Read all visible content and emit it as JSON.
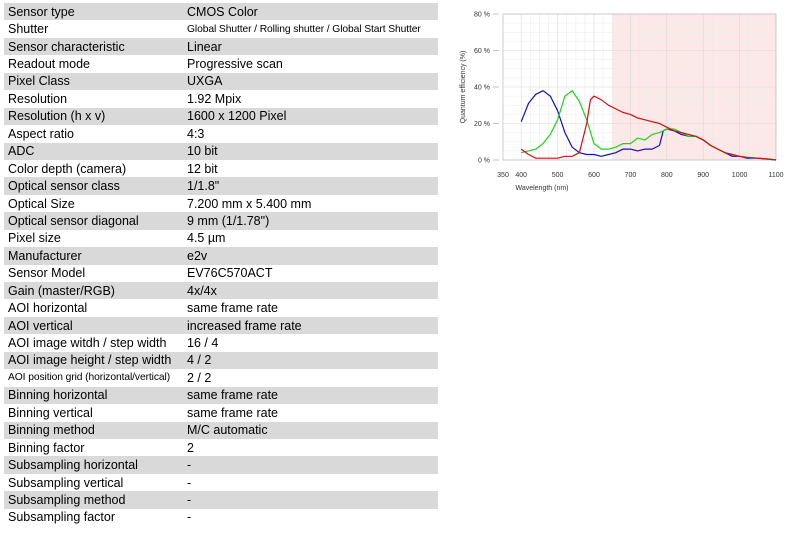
{
  "specs": [
    {
      "label": "Sensor type",
      "value": "CMOS Color"
    },
    {
      "label": "Shutter",
      "value": "Global Shutter / Rolling shutter / Global Start Shutter"
    },
    {
      "label": "Sensor characteristic",
      "value": "Linear"
    },
    {
      "label": "Readout mode",
      "value": "Progressive scan"
    },
    {
      "label": "Pixel Class",
      "value": "UXGA"
    },
    {
      "label": "Resolution",
      "value": "1.92 Mpix"
    },
    {
      "label": "Resolution (h x v)",
      "value": "1600 x 1200 Pixel"
    },
    {
      "label": "Aspect ratio",
      "value": "4:3"
    },
    {
      "label": "ADC",
      "value": "10 bit"
    },
    {
      "label": "Color depth (camera)",
      "value": "12 bit"
    },
    {
      "label": "Optical sensor class",
      "value": "1/1.8\""
    },
    {
      "label": "Optical Size",
      "value": "7.200 mm x 5.400 mm"
    },
    {
      "label": "Optical sensor diagonal",
      "value": "9 mm (1/1.78\")"
    },
    {
      "label": "Pixel size",
      "value": "4.5 µm"
    },
    {
      "label": "Manufacturer",
      "value": "e2v"
    },
    {
      "label": "Sensor Model",
      "value": "EV76C570ACT"
    },
    {
      "label": "Gain (master/RGB)",
      "value": "4x/4x"
    },
    {
      "label": "AOI horizontal",
      "value": "same frame rate"
    },
    {
      "label": "AOI vertical",
      "value": "increased frame rate"
    },
    {
      "label": "AOI image witdh / step width",
      "value": "16 / 4"
    },
    {
      "label": "AOI image height / step width",
      "value": "4 / 2"
    },
    {
      "label": "AOI position grid (horizontal/vertical)",
      "value": "2 / 2"
    },
    {
      "label": "Binning horizontal",
      "value": "same frame rate"
    },
    {
      "label": "Binning vertical",
      "value": "same frame rate"
    },
    {
      "label": "Binning method",
      "value": "M/C automatic"
    },
    {
      "label": "Binning factor",
      "value": "2"
    },
    {
      "label": "Subsampling horizontal",
      "value": "-"
    },
    {
      "label": "Subsampling vertical",
      "value": "-"
    },
    {
      "label": "Subsampling method",
      "value": "-"
    },
    {
      "label": "Subsampling factor",
      "value": "-"
    }
  ],
  "chart_data": {
    "type": "line",
    "title": "",
    "xlabel": "Wavelength (nm)",
    "ylabel": "Quantum efficiency (%)",
    "xlim": [
      350,
      1100
    ],
    "ylim": [
      0,
      80
    ],
    "x_ticks": [
      350,
      400,
      500,
      600,
      700,
      800,
      900,
      1000,
      1100
    ],
    "y_ticks": [
      0,
      20,
      40,
      60,
      80
    ],
    "y_tick_labels": [
      "0 %",
      "20 %",
      "40 %",
      "60 %",
      "80 %"
    ],
    "grid": true,
    "shaded_region": {
      "x_from": 650,
      "x_to": 1100,
      "color": "#fde8e8"
    },
    "series": [
      {
        "color": "#1010c0",
        "points": [
          [
            400,
            21
          ],
          [
            420,
            31
          ],
          [
            440,
            36
          ],
          [
            460,
            38
          ],
          [
            480,
            35
          ],
          [
            500,
            27
          ],
          [
            520,
            15
          ],
          [
            540,
            7
          ],
          [
            560,
            4
          ],
          [
            580,
            3
          ],
          [
            600,
            3
          ],
          [
            620,
            2
          ],
          [
            640,
            3
          ],
          [
            660,
            4
          ],
          [
            680,
            6
          ],
          [
            700,
            6
          ],
          [
            720,
            5
          ],
          [
            740,
            6
          ],
          [
            760,
            6
          ],
          [
            780,
            8
          ],
          [
            790,
            16
          ],
          [
            800,
            17
          ],
          [
            820,
            16
          ],
          [
            840,
            14
          ],
          [
            860,
            13
          ],
          [
            880,
            13
          ],
          [
            900,
            11
          ],
          [
            920,
            8
          ],
          [
            940,
            6
          ],
          [
            960,
            4
          ],
          [
            980,
            2
          ],
          [
            1000,
            2
          ],
          [
            1020,
            1
          ],
          [
            1050,
            1
          ],
          [
            1080,
            0.5
          ],
          [
            1100,
            0
          ]
        ]
      },
      {
        "color": "#20d020",
        "points": [
          [
            400,
            4
          ],
          [
            420,
            5
          ],
          [
            440,
            6
          ],
          [
            460,
            9
          ],
          [
            480,
            14
          ],
          [
            500,
            22
          ],
          [
            520,
            35
          ],
          [
            540,
            38
          ],
          [
            560,
            32
          ],
          [
            580,
            22
          ],
          [
            600,
            9
          ],
          [
            620,
            6
          ],
          [
            640,
            6
          ],
          [
            660,
            7
          ],
          [
            680,
            9
          ],
          [
            700,
            9
          ],
          [
            720,
            12
          ],
          [
            740,
            11
          ],
          [
            760,
            14
          ],
          [
            780,
            15
          ],
          [
            800,
            17
          ],
          [
            820,
            17
          ],
          [
            840,
            15
          ],
          [
            860,
            13
          ],
          [
            880,
            13
          ],
          [
            900,
            11
          ],
          [
            920,
            8
          ],
          [
            940,
            6
          ],
          [
            960,
            4
          ],
          [
            980,
            3
          ],
          [
            1000,
            2
          ],
          [
            1020,
            1.5
          ],
          [
            1050,
            1
          ],
          [
            1080,
            0.5
          ],
          [
            1100,
            0
          ]
        ]
      },
      {
        "color": "#d01010",
        "points": [
          [
            400,
            6
          ],
          [
            420,
            3
          ],
          [
            440,
            1
          ],
          [
            460,
            1
          ],
          [
            480,
            1
          ],
          [
            500,
            1
          ],
          [
            520,
            2
          ],
          [
            540,
            2
          ],
          [
            560,
            4
          ],
          [
            580,
            20
          ],
          [
            590,
            33
          ],
          [
            600,
            35
          ],
          [
            620,
            33
          ],
          [
            640,
            30
          ],
          [
            660,
            28
          ],
          [
            680,
            26
          ],
          [
            700,
            25
          ],
          [
            720,
            23
          ],
          [
            740,
            22
          ],
          [
            760,
            21
          ],
          [
            780,
            20
          ],
          [
            800,
            18
          ],
          [
            820,
            16
          ],
          [
            840,
            15
          ],
          [
            860,
            14
          ],
          [
            880,
            13
          ],
          [
            900,
            11
          ],
          [
            920,
            8
          ],
          [
            940,
            6
          ],
          [
            960,
            4
          ],
          [
            980,
            3
          ],
          [
            1000,
            2
          ],
          [
            1020,
            1.5
          ],
          [
            1050,
            1
          ],
          [
            1080,
            0.5
          ],
          [
            1100,
            0
          ]
        ]
      }
    ]
  }
}
